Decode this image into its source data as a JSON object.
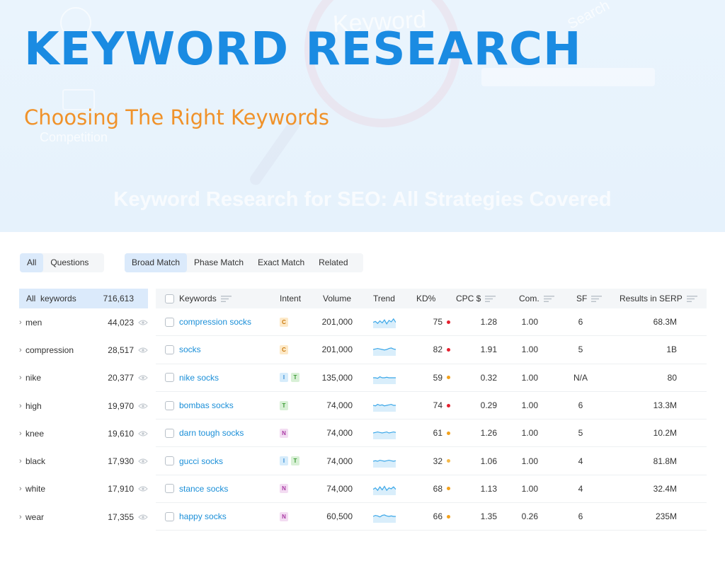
{
  "hero": {
    "title": "KEYWORD RESEARCH",
    "subtitle": "Choosing The Right Keywords",
    "bg_word": "Keyword",
    "bg_search": "Search",
    "bg_competition": "Competition",
    "bg_caption": "Keyword Research for SEO: All Strategies Covered"
  },
  "tabs_group1": [
    {
      "label": "All",
      "active": true
    },
    {
      "label": "Questions",
      "active": false
    }
  ],
  "tabs_group2": [
    {
      "label": "Broad Match",
      "active": true
    },
    {
      "label": "Phase Match",
      "active": false
    },
    {
      "label": "Exact Match",
      "active": false
    },
    {
      "label": "Related",
      "active": false
    }
  ],
  "left_panel": {
    "header_label": "All  keywords",
    "header_count": "716,613",
    "items": [
      {
        "label": "men",
        "count": "44,023"
      },
      {
        "label": "compression",
        "count": "28,517"
      },
      {
        "label": "nike",
        "count": "20,377"
      },
      {
        "label": "high",
        "count": "19,970"
      },
      {
        "label": "knee",
        "count": "19,610"
      },
      {
        "label": "black",
        "count": "17,930"
      },
      {
        "label": "white",
        "count": "17,910"
      },
      {
        "label": "wear",
        "count": "17,355"
      }
    ]
  },
  "table": {
    "columns": {
      "keywords": "Keywords",
      "intent": "Intent",
      "volume": "Volume",
      "trend": "Trend",
      "kd": "KD%",
      "cpc": "CPC $",
      "com": "Com.",
      "sf": "SF",
      "results": "Results in SERP"
    },
    "rows": [
      {
        "keyword": "compression socks",
        "intent": [
          "C"
        ],
        "volume": "201,000",
        "kd": "75",
        "kd_color": "#e5202e",
        "cpc": "1.28",
        "com": "1.00",
        "sf": "6",
        "results": "68.3M",
        "trend": [
          0.45,
          0.55,
          0.35,
          0.6,
          0.4,
          0.7,
          0.3,
          0.65,
          0.5,
          0.8,
          0.45
        ]
      },
      {
        "keyword": "socks",
        "intent": [
          "C"
        ],
        "volume": "201,000",
        "kd": "82",
        "kd_color": "#e5202e",
        "cpc": "1.91",
        "com": "1.00",
        "sf": "5",
        "results": "1B",
        "trend": [
          0.5,
          0.55,
          0.6,
          0.55,
          0.5,
          0.45,
          0.5,
          0.6,
          0.65,
          0.55,
          0.5
        ]
      },
      {
        "keyword": "nike socks",
        "intent": [
          "I",
          "T"
        ],
        "volume": "135,000",
        "kd": "59",
        "kd_color": "#f2a11c",
        "cpc": "0.32",
        "com": "1.00",
        "sf": "N/A",
        "results": "80",
        "trend": [
          0.5,
          0.5,
          0.45,
          0.6,
          0.5,
          0.5,
          0.55,
          0.5,
          0.5,
          0.5,
          0.5
        ]
      },
      {
        "keyword": "bombas socks",
        "intent": [
          "T"
        ],
        "volume": "74,000",
        "kd": "74",
        "kd_color": "#e5202e",
        "cpc": "0.29",
        "com": "1.00",
        "sf": "6",
        "results": "13.3M",
        "trend": [
          0.5,
          0.45,
          0.6,
          0.5,
          0.55,
          0.45,
          0.5,
          0.55,
          0.6,
          0.5,
          0.5
        ]
      },
      {
        "keyword": "darn tough socks",
        "intent": [
          "N"
        ],
        "volume": "74,000",
        "kd": "61",
        "kd_color": "#f2a11c",
        "cpc": "1.26",
        "com": "1.00",
        "sf": "5",
        "results": "10.2M",
        "trend": [
          0.5,
          0.55,
          0.6,
          0.55,
          0.5,
          0.55,
          0.6,
          0.5,
          0.55,
          0.6,
          0.55
        ]
      },
      {
        "keyword": "gucci socks",
        "intent": [
          "I",
          "T"
        ],
        "volume": "74,000",
        "kd": "32",
        "kd_color": "#f5b94a",
        "cpc": "1.06",
        "com": "1.00",
        "sf": "4",
        "results": "81.8M",
        "trend": [
          0.5,
          0.55,
          0.5,
          0.6,
          0.55,
          0.5,
          0.55,
          0.6,
          0.55,
          0.5,
          0.55
        ]
      },
      {
        "keyword": "stance socks",
        "intent": [
          "N"
        ],
        "volume": "74,000",
        "kd": "68",
        "kd_color": "#f2a11c",
        "cpc": "1.13",
        "com": "1.00",
        "sf": "4",
        "results": "32.4M",
        "trend": [
          0.45,
          0.6,
          0.35,
          0.7,
          0.4,
          0.75,
          0.35,
          0.6,
          0.5,
          0.7,
          0.45
        ]
      },
      {
        "keyword": "happy socks",
        "intent": [
          "N"
        ],
        "volume": "60,500",
        "kd": "66",
        "kd_color": "#f2a11c",
        "cpc": "1.35",
        "com": "0.26",
        "sf": "6",
        "results": "235M",
        "trend": [
          0.5,
          0.6,
          0.55,
          0.45,
          0.6,
          0.65,
          0.55,
          0.5,
          0.55,
          0.5,
          0.5
        ]
      }
    ]
  },
  "colors": {
    "title_blue": "#1a8be2",
    "subtitle_orange": "#f0922a",
    "link_blue": "#1b8fd8",
    "active_tab": "#dbeafb",
    "trend_line": "#3ba7e8"
  },
  "icons": {
    "row_expand": "chevron-right-icon",
    "row_view": "eye-icon",
    "column_sort": "sort-lines-icon"
  }
}
